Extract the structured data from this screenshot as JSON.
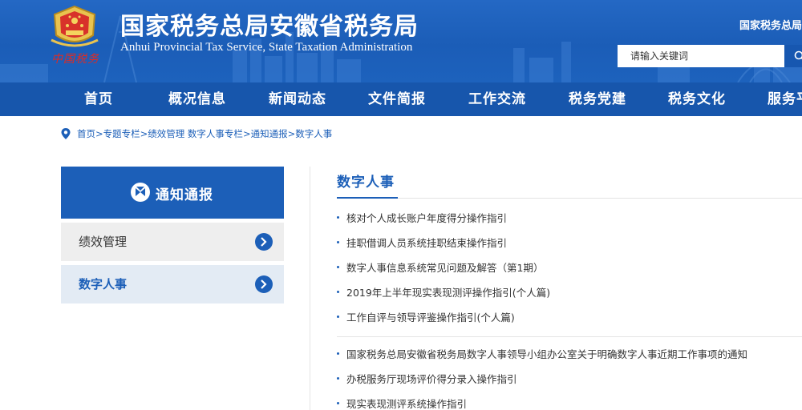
{
  "header": {
    "title": "国家税务总局安徽省税务局",
    "subtitle": "Anhui Provincial Tax Service, State Taxation Administration",
    "emblem_text": "中国税务",
    "top_link": "国家税务总局",
    "search_placeholder": "请输入关键词",
    "colors": {
      "header_bg": "#1b5db7",
      "nav_bg": "#1756ac",
      "accent": "#1c5fb8",
      "emblem_red": "#e12b22"
    }
  },
  "nav": {
    "items": [
      "首页",
      "概况信息",
      "新闻动态",
      "文件简报",
      "工作交流",
      "税务党建",
      "税务文化",
      "服务平"
    ]
  },
  "breadcrumb": {
    "icon": "location-pin-icon",
    "items": [
      "首页",
      "专题专栏",
      "绩效管理 数字人事专栏",
      "通知通报",
      "数字人事"
    ],
    "separator": ">"
  },
  "sidebar": {
    "title": "通知通报",
    "title_icon": "section-logo-icon",
    "items": [
      {
        "label": "绩效管理",
        "icon": "chevron-right-circle-icon"
      },
      {
        "label": "数字人事",
        "icon": "chevron-right-circle-icon"
      }
    ]
  },
  "main": {
    "title": "数字人事",
    "articles": [
      "核对个人成长账户年度得分操作指引",
      "挂职借调人员系统挂职结束操作指引",
      "数字人事信息系统常见问题及解答（第1期）",
      "2019年上半年现实表现测评操作指引(个人篇)",
      "工作自评与领导评鉴操作指引(个人篇)",
      "国家税务总局安徽省税务局数字人事领导小组办公室关于明确数字人事近期工作事项的通知",
      "办税服务厅现场评价得分录入操作指引",
      "现实表现测评系统操作指引"
    ]
  }
}
